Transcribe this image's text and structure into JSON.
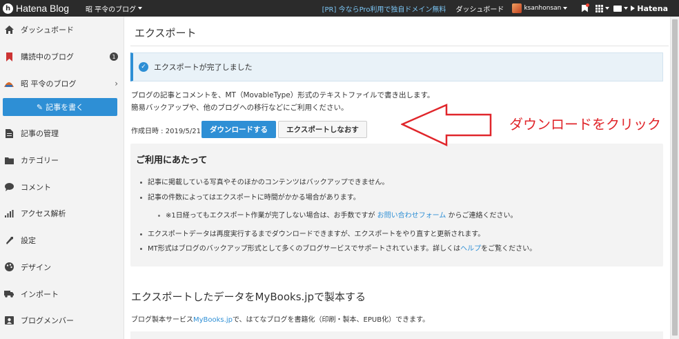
{
  "topbar": {
    "brand": "Hatena Blog",
    "blog_switch": "昭 平令のブログ",
    "promo": "[PR] 今ならPro利用で独自ドメイン無料",
    "dashboard": "ダッシュボード",
    "username": "ksanhonsan",
    "hatena": "Hatena"
  },
  "sidebar": {
    "items": [
      {
        "label": "ダッシュボード",
        "icon": "home-icon"
      },
      {
        "label": "購読中のブログ",
        "icon": "bookmark-icon",
        "badge": "1"
      },
      {
        "label": "昭 平令のブログ",
        "icon": "blog-icon"
      },
      {
        "label": "記事の管理",
        "icon": "document-icon"
      },
      {
        "label": "カテゴリー",
        "icon": "folder-icon"
      },
      {
        "label": "コメント",
        "icon": "comment-icon"
      },
      {
        "label": "アクセス解析",
        "icon": "chart-icon"
      },
      {
        "label": "設定",
        "icon": "wrench-icon"
      },
      {
        "label": "デザイン",
        "icon": "palette-icon"
      },
      {
        "label": "インポート",
        "icon": "truck-icon"
      },
      {
        "label": "ブログメンバー",
        "icon": "members-icon"
      }
    ],
    "write_button": "記事を書く"
  },
  "main": {
    "title": "エクスポート",
    "alert": "エクスポートが完了しました",
    "desc1": "ブログの記事とコメントを、MT（MovableType）形式のテキストファイルで書き出します。",
    "desc2": "簡易バックアップや、他のブログへの移行などにご利用ください。",
    "created": "作成日時 : 2019/5/21",
    "download_button": "ダウンロードする",
    "reexport_button": "エクスポートしなおす",
    "notice": {
      "title": "ご利用にあたって",
      "l1": "記事に掲載している写真やそのほかのコンテンツはバックアップできません。",
      "l2": "記事の件数によってはエクスポートに時間がかかる場合があります。",
      "l3_prefix": "※1日経ってもエクスポート作業が完了しない場合は、お手数ですが",
      "l3_link": "お問い合わせフォーム",
      "l3_suffix": "からご連絡ください。",
      "l4": "エクスポートデータは再度実行するまでダウンロードできますが、エクスポートをやり直すと更新されます。",
      "l5_prefix": "MT形式はブログのバックアップ形式として多くのブログサービスでサポートされています。詳しくは",
      "l5_link": "ヘルプ",
      "l5_suffix": "をご覧ください。"
    },
    "mybooks_title": "エクスポートしたデータをMyBooks.jpで製本する",
    "mybooks_prefix": "ブログ製本サービス",
    "mybooks_link": "MyBooks.jp",
    "mybooks_suffix": "で、はてなブログを書籍化（印刷・製本、EPUB化）できます。"
  },
  "annotation": {
    "text": "ダウンロードをクリック",
    "color": "#e0262b"
  },
  "colors": {
    "accent": "#2e8fd5",
    "topbar": "#2b2b2b"
  }
}
